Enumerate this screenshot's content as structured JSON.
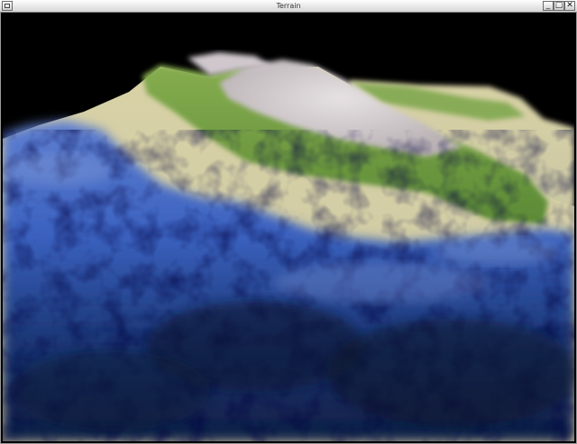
{
  "window": {
    "title": "Terrain",
    "buttons": {
      "minimize": "_",
      "maximize": "□",
      "close": "✕"
    }
  },
  "scene": {
    "description_colors": {
      "sky": "#000000",
      "deep_water": "#0d1f3c",
      "water": "#2f56b0",
      "shallow_water": "#6f86c8",
      "sand": "#d8cfa0",
      "grass": "#6f9a3c",
      "rock": "#c9c2c6"
    }
  }
}
